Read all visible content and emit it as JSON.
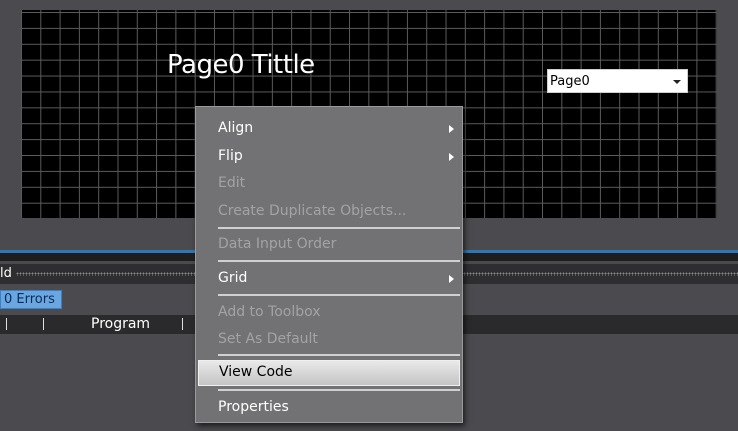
{
  "canvas": {
    "page_title": "Page0 Tittle",
    "page_select": {
      "value": "Page0"
    }
  },
  "build_panel": {
    "label": "ld",
    "errors": "0  Errors",
    "columns": {
      "program": "Program"
    }
  },
  "context_menu": {
    "items": [
      {
        "label": "Align",
        "enabled": true,
        "submenu": true
      },
      {
        "label": "Flip",
        "enabled": true,
        "submenu": true
      },
      {
        "label": "Edit",
        "enabled": false
      },
      {
        "label": "Create Duplicate Objects...",
        "enabled": false
      },
      {
        "label": "Data Input Order",
        "enabled": false
      },
      {
        "label": "Grid",
        "enabled": true,
        "submenu": true
      },
      {
        "label": "Add to Toolbox",
        "enabled": false
      },
      {
        "label": "Set As Default",
        "enabled": false
      },
      {
        "label": "View Code",
        "enabled": true,
        "highlighted": true
      },
      {
        "label": "Properties",
        "enabled": true
      }
    ]
  },
  "colors": {
    "background": "#4b4b4f",
    "canvas": "#000000",
    "menu": "#727274",
    "accent": "#2f78b8",
    "errors_badge": "#6aa7e0"
  }
}
